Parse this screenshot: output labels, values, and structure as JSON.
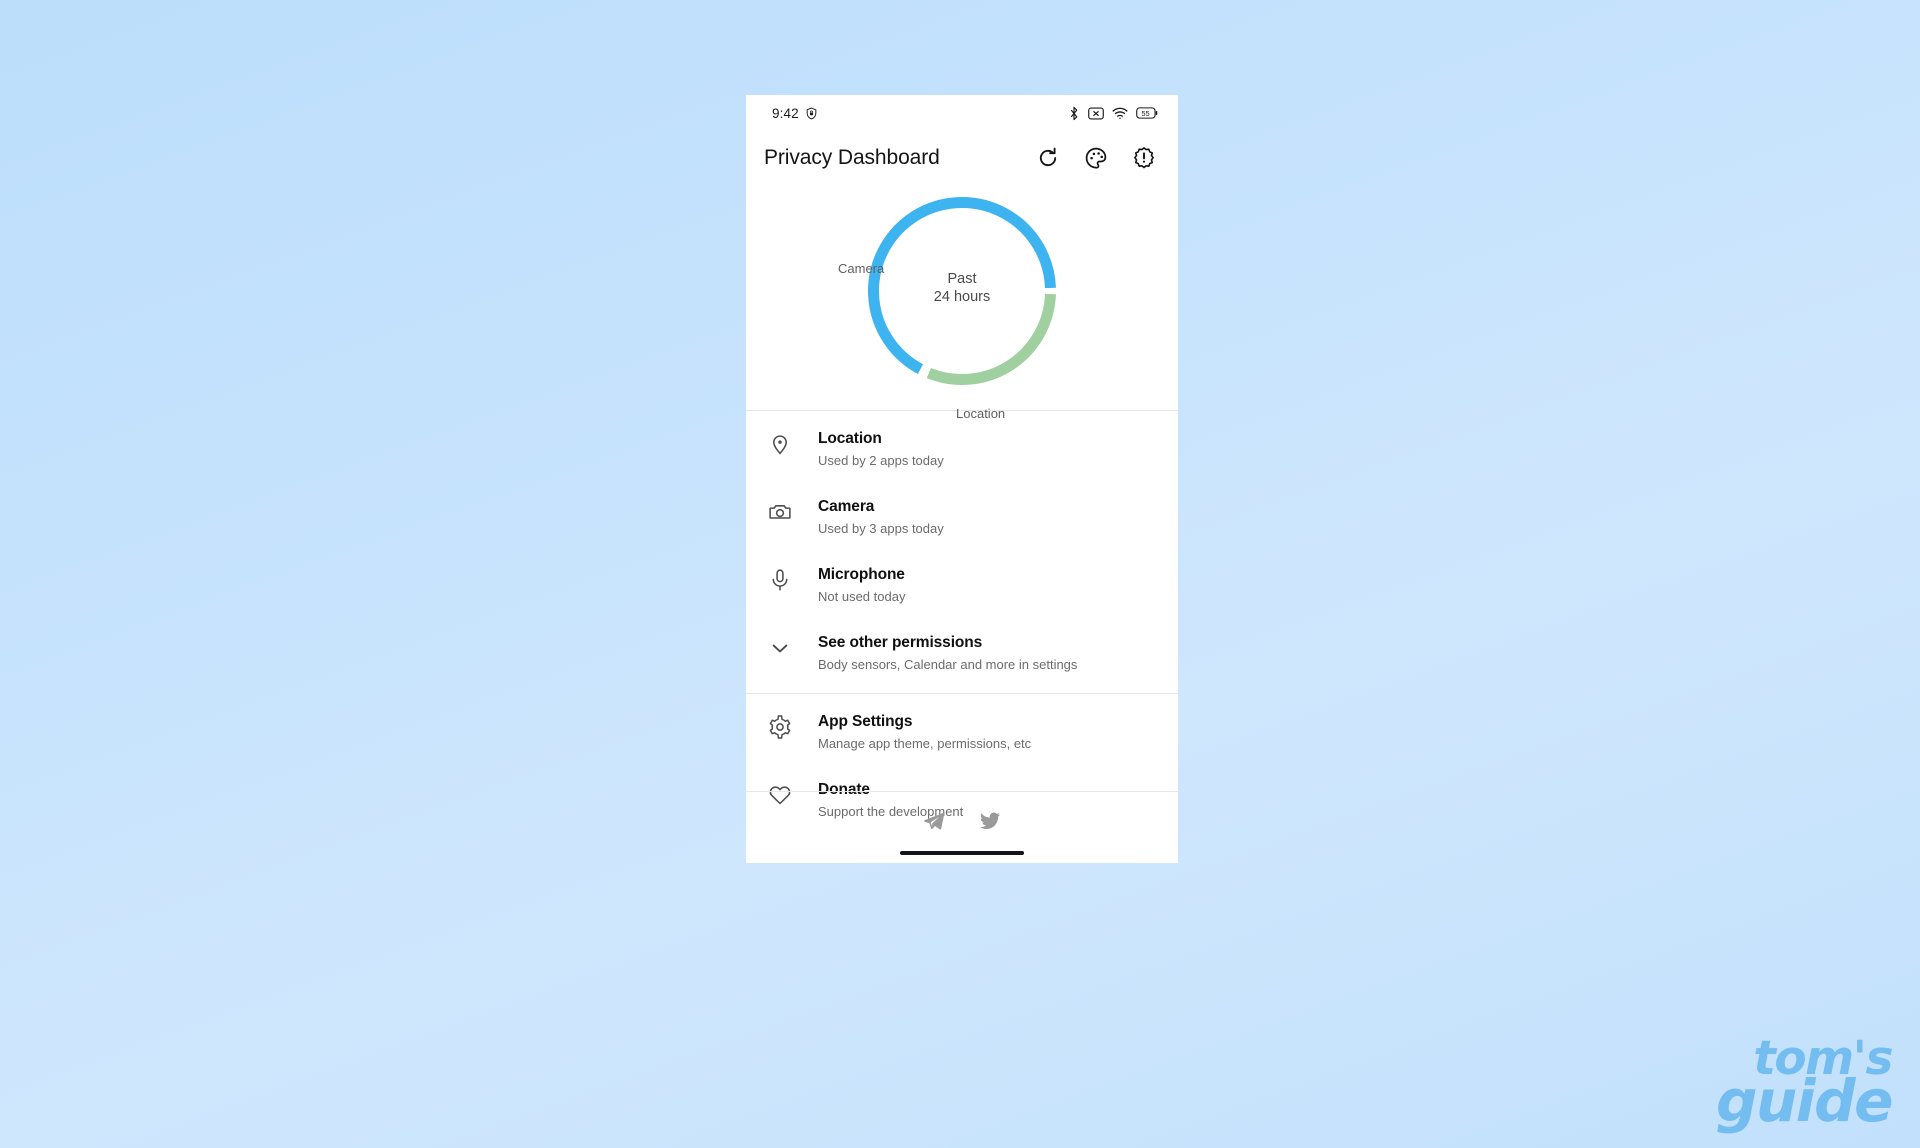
{
  "background": {
    "color_top": "#bcdefb",
    "color_bottom": "#c2e0fc"
  },
  "status_bar": {
    "time": "9:42",
    "shield_icon": "shield-vpn-icon",
    "bluetooth_icon": "bluetooth-icon",
    "no_sim_icon": "no-sim-icon",
    "wifi_icon": "wifi-icon",
    "battery_icon": "battery-icon",
    "battery_level": "55"
  },
  "app_bar": {
    "title": "Privacy Dashboard",
    "actions": [
      {
        "name": "refresh-button",
        "icon": "refresh-icon"
      },
      {
        "name": "theme-button",
        "icon": "palette-icon"
      },
      {
        "name": "about-button",
        "icon": "info-badge-icon"
      }
    ]
  },
  "chart_data": {
    "type": "pie",
    "title": "",
    "center_line1": "Past",
    "center_line2": "24 hours",
    "legend_position": "around-arc",
    "categories": [
      "Camera",
      "Location"
    ],
    "values": [
      67,
      33
    ],
    "series": [
      {
        "name": "Camera",
        "value": 67,
        "color": "#3db4ef",
        "start_deg": 208,
        "sweep_deg": 240
      },
      {
        "name": "Location",
        "value": 33,
        "color": "#a0cfa0",
        "start_deg": 452,
        "sweep_deg": 110
      }
    ],
    "colors": {
      "camera": "#3db4ef",
      "location": "#a0cfa0"
    },
    "labels": {
      "camera": "Camera",
      "location": "Location"
    }
  },
  "permissions": [
    {
      "icon": "location-pin-icon",
      "name": "row-location",
      "title": "Location",
      "subtitle": "Used by 2 apps today"
    },
    {
      "icon": "camera-icon",
      "name": "row-camera",
      "title": "Camera",
      "subtitle": "Used by 3 apps today"
    },
    {
      "icon": "microphone-icon",
      "name": "row-microphone",
      "title": "Microphone",
      "subtitle": "Not used today"
    },
    {
      "icon": "chevron-down-icon",
      "name": "row-other-permissions",
      "title": "See other permissions",
      "subtitle": "Body sensors, Calendar and more in settings"
    }
  ],
  "app_options": [
    {
      "icon": "gear-icon",
      "name": "row-app-settings",
      "title": "App Settings",
      "subtitle": "Manage app theme, permissions, etc"
    },
    {
      "icon": "heart-icon",
      "name": "row-donate",
      "title": "Donate",
      "subtitle": "Support the development"
    }
  ],
  "footer": {
    "social": [
      {
        "name": "telegram-link",
        "icon": "telegram-icon"
      },
      {
        "name": "twitter-link",
        "icon": "twitter-icon"
      }
    ]
  },
  "watermark": {
    "line1": "tom's",
    "line2": "guide",
    "color": "#74bdf0"
  }
}
